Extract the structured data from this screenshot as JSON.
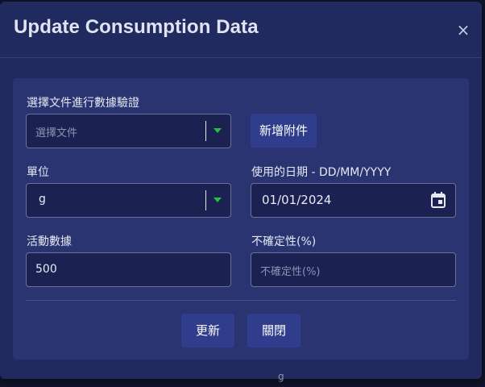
{
  "modal": {
    "title": "Update Consumption Data",
    "close_label": "×"
  },
  "form": {
    "document": {
      "label": "選擇文件進行數據驗證",
      "placeholder": "選擇文件",
      "add_attachment_label": "新增附件"
    },
    "unit": {
      "label": "單位",
      "value": "g"
    },
    "usage_date": {
      "label": "使用的日期 - DD/MM/YYYY",
      "value": "01/01/2024"
    },
    "activity_data": {
      "label": "活動數據",
      "value": "500"
    },
    "uncertainty": {
      "label": "不確定性(%)",
      "placeholder": "不確定性(%)"
    }
  },
  "actions": {
    "update_label": "更新",
    "close_label": "關閉"
  },
  "background_text": "g",
  "icons": {
    "close": "close-icon",
    "caret": "chevron-down-icon",
    "calendar": "calendar-icon"
  },
  "colors": {
    "modal_bg": "#212a5e",
    "card_bg": "#2a3470",
    "button_bg": "#2f3d8c",
    "caret": "#22c33a"
  }
}
